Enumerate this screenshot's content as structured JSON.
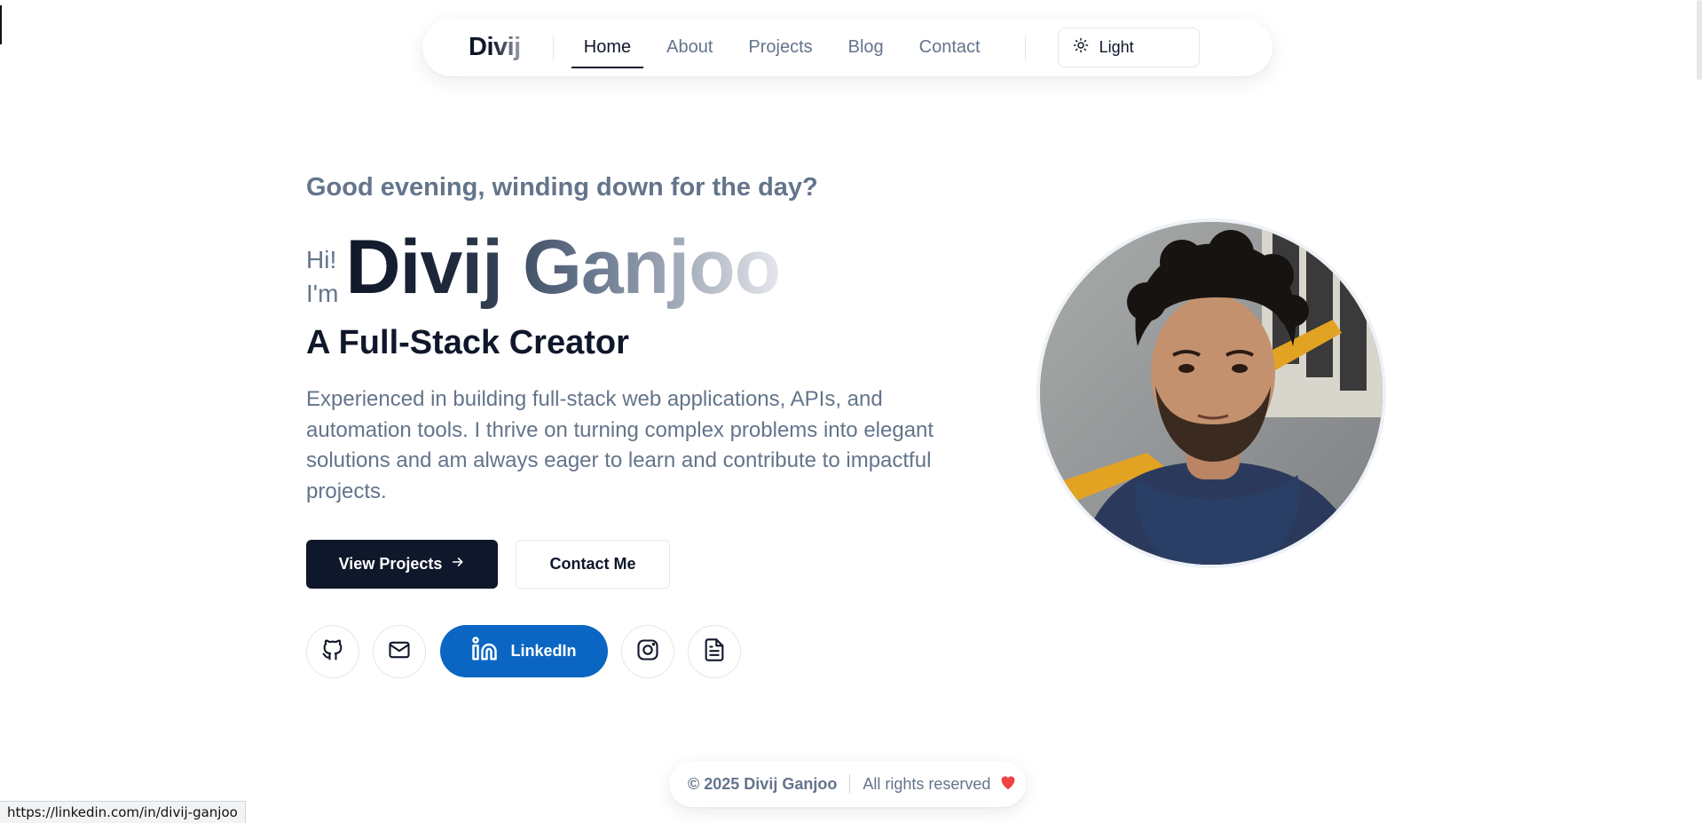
{
  "nav": {
    "brand": "Divij",
    "links": [
      "Home",
      "About",
      "Projects",
      "Blog",
      "Contact"
    ],
    "active": "Home",
    "theme_label": "Light",
    "theme_icon": "sun-icon"
  },
  "hero": {
    "greeting": "Good evening, winding down for the day?",
    "hi_line1": "Hi!",
    "hi_line2": "I'm",
    "name": "Divij Ganjoo",
    "role": "A Full-Stack Creator",
    "description": "Experienced in building full-stack web applications, APIs, and automation tools. I thrive on turning complex problems into elegant solutions and am always eager to learn and contribute to impactful projects.",
    "primary_button": "View Projects",
    "secondary_button": "Contact Me",
    "socials": {
      "github_icon": "github-icon",
      "mail_icon": "mail-icon",
      "linkedin_label": "LinkedIn",
      "instagram_icon": "instagram-icon",
      "resume_icon": "document-icon"
    }
  },
  "footer": {
    "copyright": "© 2025 Divij Ganjoo",
    "rights": "All rights reserved"
  },
  "statusbar": {
    "url": "https://linkedin.com/in/divij-ganjoo"
  },
  "colors": {
    "primary": "#0f172a",
    "muted": "#64748b",
    "linkedin": "#0a66c2",
    "heart": "#ef4444"
  }
}
